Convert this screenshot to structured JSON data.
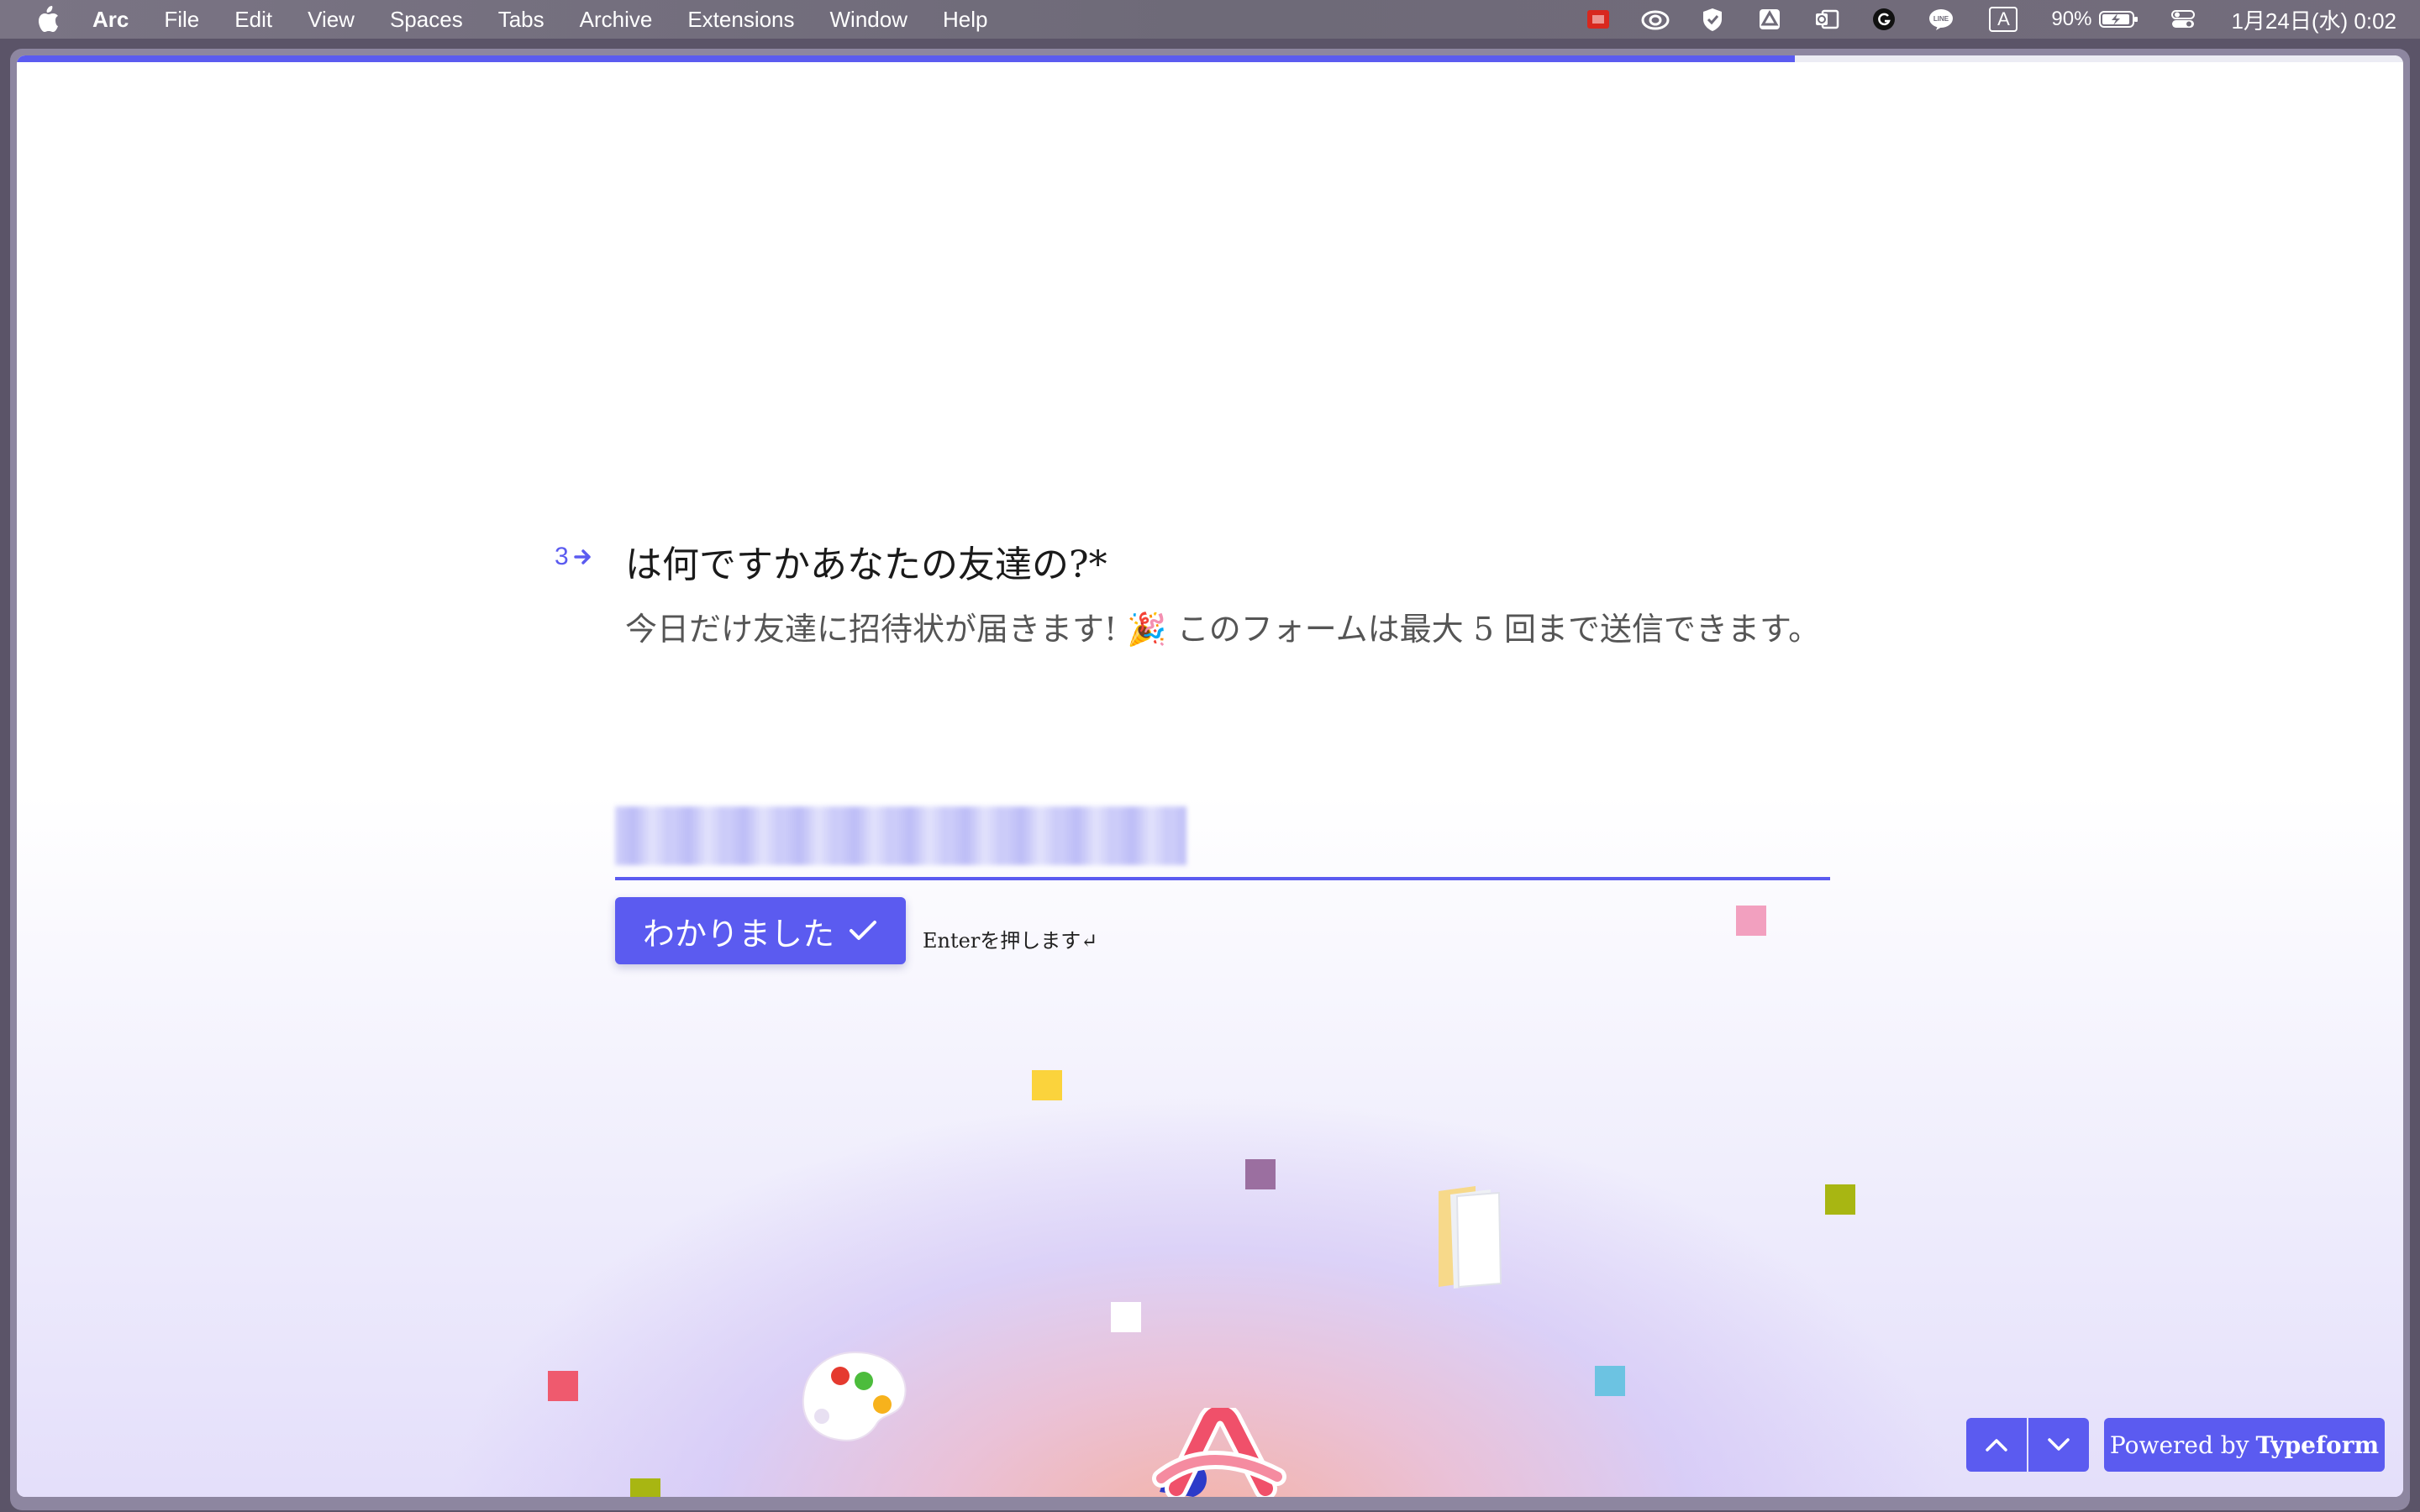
{
  "menubar": {
    "app_name": "Arc",
    "menus": [
      "File",
      "Edit",
      "View",
      "Spaces",
      "Tabs",
      "Archive",
      "Extensions",
      "Window",
      "Help"
    ],
    "input_indicator": "A",
    "battery_percent": "90%",
    "clock": "1月24日(水) 0:02",
    "tray_icons": [
      "red-app-icon",
      "creative-cloud-icon",
      "security-shield-icon",
      "google-drive-icon",
      "outlook-icon",
      "grammarly-icon",
      "line-icon",
      "input-source-icon",
      "battery-icon",
      "control-center-icon"
    ]
  },
  "progress": {
    "fraction": 0.745
  },
  "form": {
    "question_number": "3",
    "question_title": "は何ですかあなたの友達の?*",
    "description": "今日だけ友達に招待状が届きます! 🎉 このフォームは最大 5 回まで送信できます。",
    "answer_value_redacted": true,
    "ok_button_label": "わかりました",
    "enter_hint": "Enterを押します↵"
  },
  "footer": {
    "powered_by_prefix": "Powered by",
    "powered_by_brand": "Typeform"
  },
  "colors": {
    "accent": "#5b5bf0",
    "confetti_pink": "#f2a0bf",
    "confetti_yellow": "#fbd33c",
    "confetti_purple": "#9b6fa0",
    "confetti_olive": "#a8b612",
    "confetti_red": "#ef5a6e",
    "confetti_blue": "#6cc3e2"
  }
}
